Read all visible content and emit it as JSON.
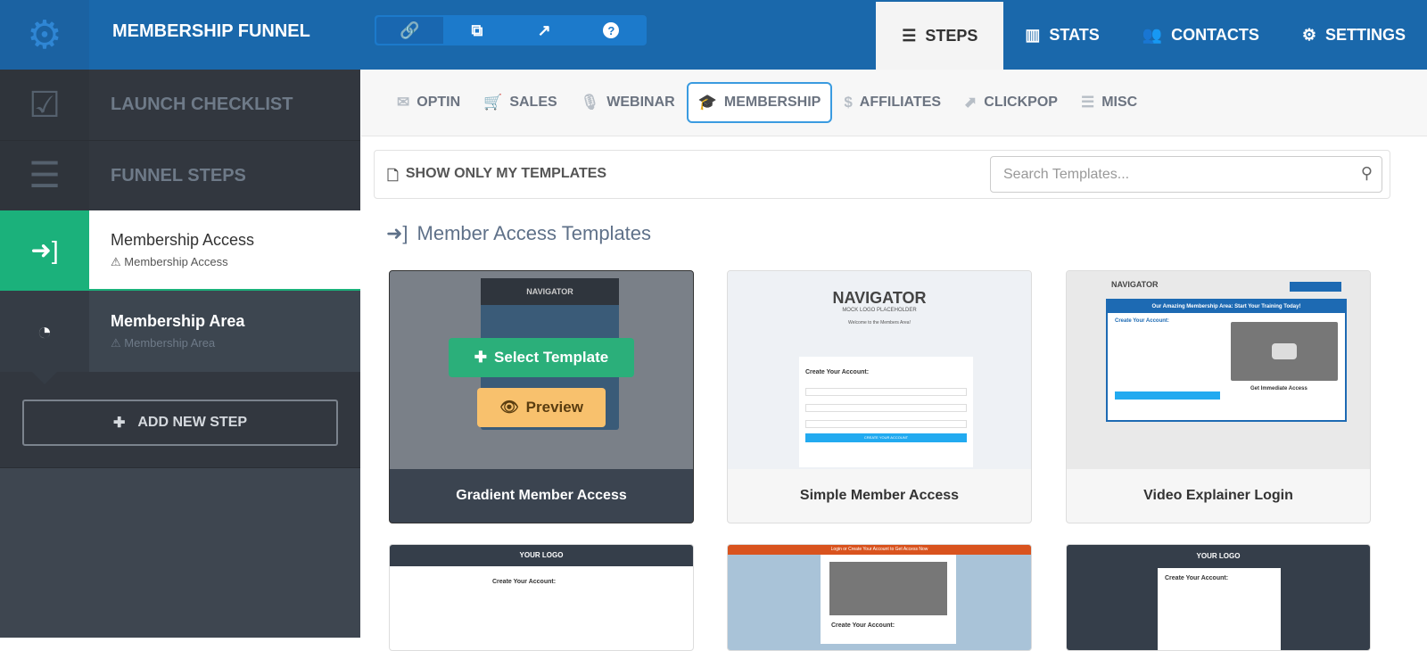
{
  "header": {
    "title": "MEMBERSHIP FUNNEL",
    "tools": [
      "link-icon",
      "copy-icon",
      "external-link-icon",
      "help-icon"
    ],
    "nav": [
      {
        "label": "STEPS",
        "icon": "☰"
      },
      {
        "label": "STATS",
        "icon": "▥"
      },
      {
        "label": "CONTACTS",
        "icon": "👥"
      },
      {
        "label": "SETTINGS",
        "icon": "⚙"
      }
    ]
  },
  "sidebar": {
    "launch": "LAUNCH CHECKLIST",
    "funnel_steps": "FUNNEL STEPS",
    "steps": [
      {
        "title": "Membership Access",
        "sub": "Membership Access"
      },
      {
        "title": "Membership Area",
        "sub": "Membership Area"
      }
    ],
    "add": "ADD NEW STEP"
  },
  "categories": [
    {
      "label": "OPTIN",
      "icon": "✉"
    },
    {
      "label": "SALES",
      "icon": "🛒"
    },
    {
      "label": "WEBINAR",
      "icon": "🎙"
    },
    {
      "label": "MEMBERSHIP",
      "icon": "🎓"
    },
    {
      "label": "AFFILIATES",
      "icon": "$"
    },
    {
      "label": "CLICKPOP",
      "icon": "⬈"
    },
    {
      "label": "MISC",
      "icon": "☰"
    }
  ],
  "filter": {
    "show_mine": "SHOW ONLY MY TEMPLATES",
    "search_placeholder": "Search Templates..."
  },
  "section_title": "Member Access Templates",
  "hover": {
    "select": "Select Template",
    "preview": "Preview"
  },
  "templates": [
    {
      "name": "Gradient Member Access"
    },
    {
      "name": "Simple Member Access"
    },
    {
      "name": "Video Explainer Login"
    }
  ],
  "thumbs": {
    "navigator": "NAVIGATOR",
    "mock": "MOCK LOGO PLACEHOLDER",
    "welcome": "Welcome to the Members Area!",
    "create": "Create Your Account:",
    "create_btn": "CREATE YOUR ACCOUNT",
    "video_head": "Our Amazing Membership Area: Start Your Training Today!",
    "immediate": "Get Immediate Access",
    "your_logo": "YOUR LOGO",
    "login_bar": "Login or Create Your Account to Get Access Now"
  },
  "colors": {
    "brand": "#1a68ab",
    "green": "#1bb17b",
    "select": "#2baf7a",
    "preview": "#f8c16d"
  }
}
